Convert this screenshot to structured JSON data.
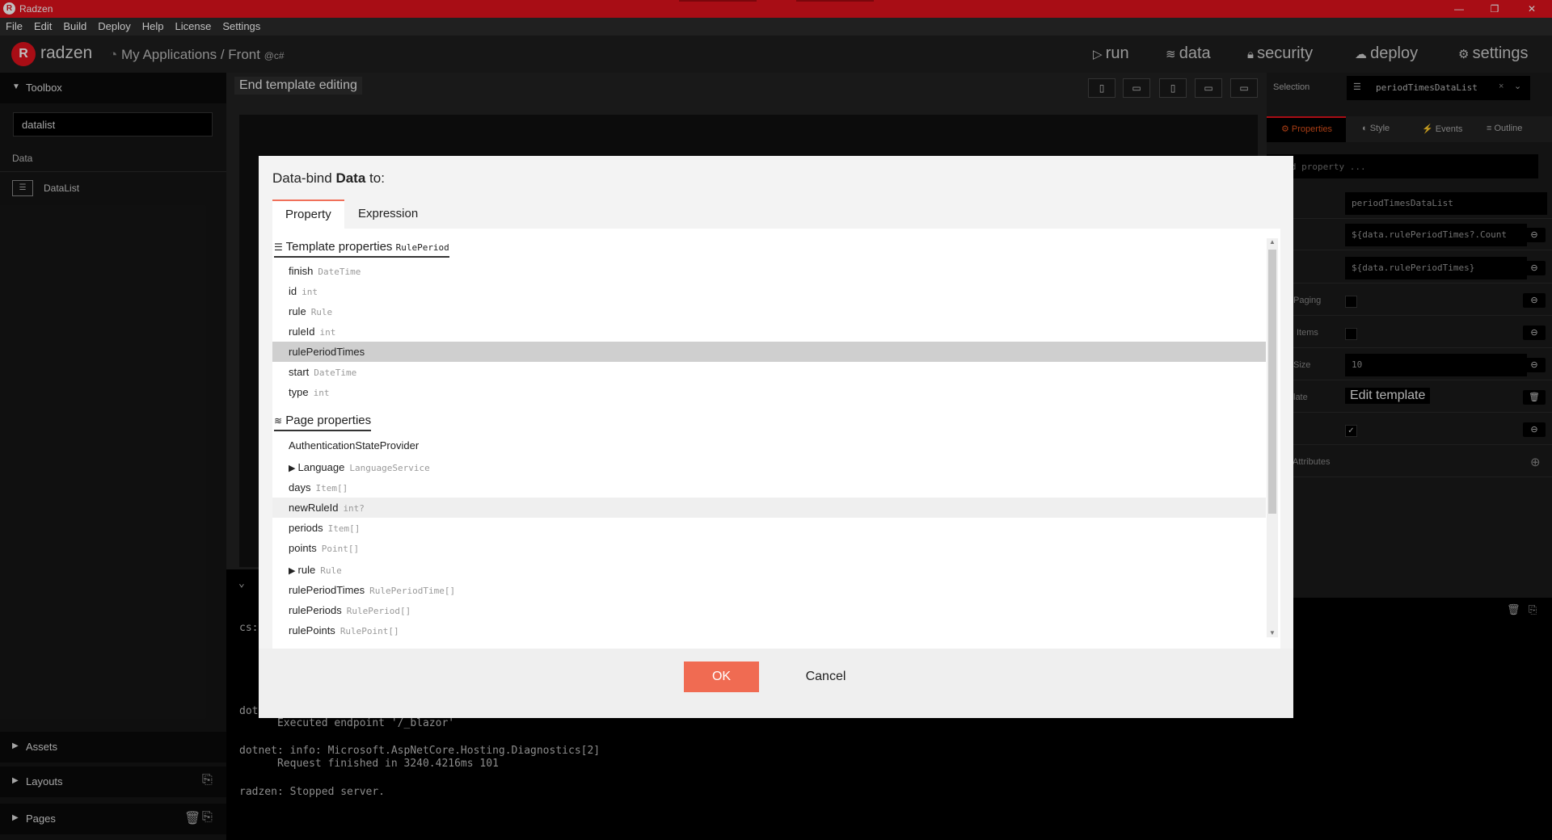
{
  "window": {
    "title": "Radzen",
    "logo_letter": "R",
    "minimize": "—",
    "restore": "❐",
    "close": "✕"
  },
  "menu": [
    "File",
    "Edit",
    "Build",
    "Deploy",
    "Help",
    "License",
    "Settings"
  ],
  "header": {
    "brand": "radzen",
    "breadcrumb": "My Applications / Front",
    "breadcrumb_badge": "@c#",
    "nav": {
      "run": "run",
      "data": "data",
      "security": "security",
      "deploy": "deploy",
      "settings": "settings"
    }
  },
  "toolbox": {
    "title": "Toolbox",
    "search_value": "datalist",
    "section": "Data",
    "item": "DataList",
    "assets": "Assets",
    "layouts": "Layouts",
    "pages": "Pages"
  },
  "canvas": {
    "end_template": "End template editing"
  },
  "output": {
    "prompt1": "cs:",
    "prompt2": "dot",
    "line1": "      Executed endpoint '/_blazor'",
    "line2": "dotnet: info: Microsoft.AspNetCore.Hosting.Diagnostics[2]",
    "line3": "      Request finished in 3240.4216ms 101",
    "line4": "radzen: Stopped server."
  },
  "properties_panel": {
    "selection_label": "Selection",
    "selection_value": "periodTimesDataList",
    "tabs": {
      "properties": "Properties",
      "style": "Style",
      "events": "Events",
      "outline": "Outline"
    },
    "find_placeholder": "Find property ...",
    "rows": {
      "name_value": "periodTimesDataList",
      "count_value": "${data.rulePeriodTimes?.Count",
      "data_value": "${data.rulePeriodTimes}",
      "paging_label": "Paging",
      "items_label": "Items",
      "size_label": "Size",
      "size_value": "10",
      "template_label": "late",
      "edit_template": "Edit template",
      "attributes_label": "Attributes"
    }
  },
  "dialog": {
    "title_prefix": "Data-bind ",
    "title_bold": "Data",
    "title_suffix": " to:",
    "tabs": {
      "property": "Property",
      "expression": "Expression"
    },
    "template_group": {
      "label": "Template properties",
      "type": "RulePeriod"
    },
    "template_items": [
      {
        "name": "finish",
        "type": "DateTime"
      },
      {
        "name": "id",
        "type": "int"
      },
      {
        "name": "rule",
        "type": "Rule"
      },
      {
        "name": "ruleId",
        "type": "int"
      },
      {
        "name": "rulePeriodTimes",
        "type": ""
      },
      {
        "name": "start",
        "type": "DateTime"
      },
      {
        "name": "type",
        "type": "int"
      }
    ],
    "page_group": {
      "label": "Page properties"
    },
    "page_items": [
      {
        "name": "AuthenticationStateProvider",
        "type": ""
      },
      {
        "name": "Language",
        "type": "LanguageService"
      },
      {
        "name": "days",
        "type": "Item[]"
      },
      {
        "name": "newRuleId",
        "type": "int?"
      },
      {
        "name": "periods",
        "type": "Item[]"
      },
      {
        "name": "points",
        "type": "Point[]"
      },
      {
        "name": "rule",
        "type": "Rule"
      },
      {
        "name": "rulePeriodTimes",
        "type": "RulePeriodTime[]"
      },
      {
        "name": "rulePeriods",
        "type": "RulePeriod[]"
      },
      {
        "name": "rulePoints",
        "type": "RulePoint[]"
      }
    ],
    "ok": "OK",
    "cancel": "Cancel"
  }
}
